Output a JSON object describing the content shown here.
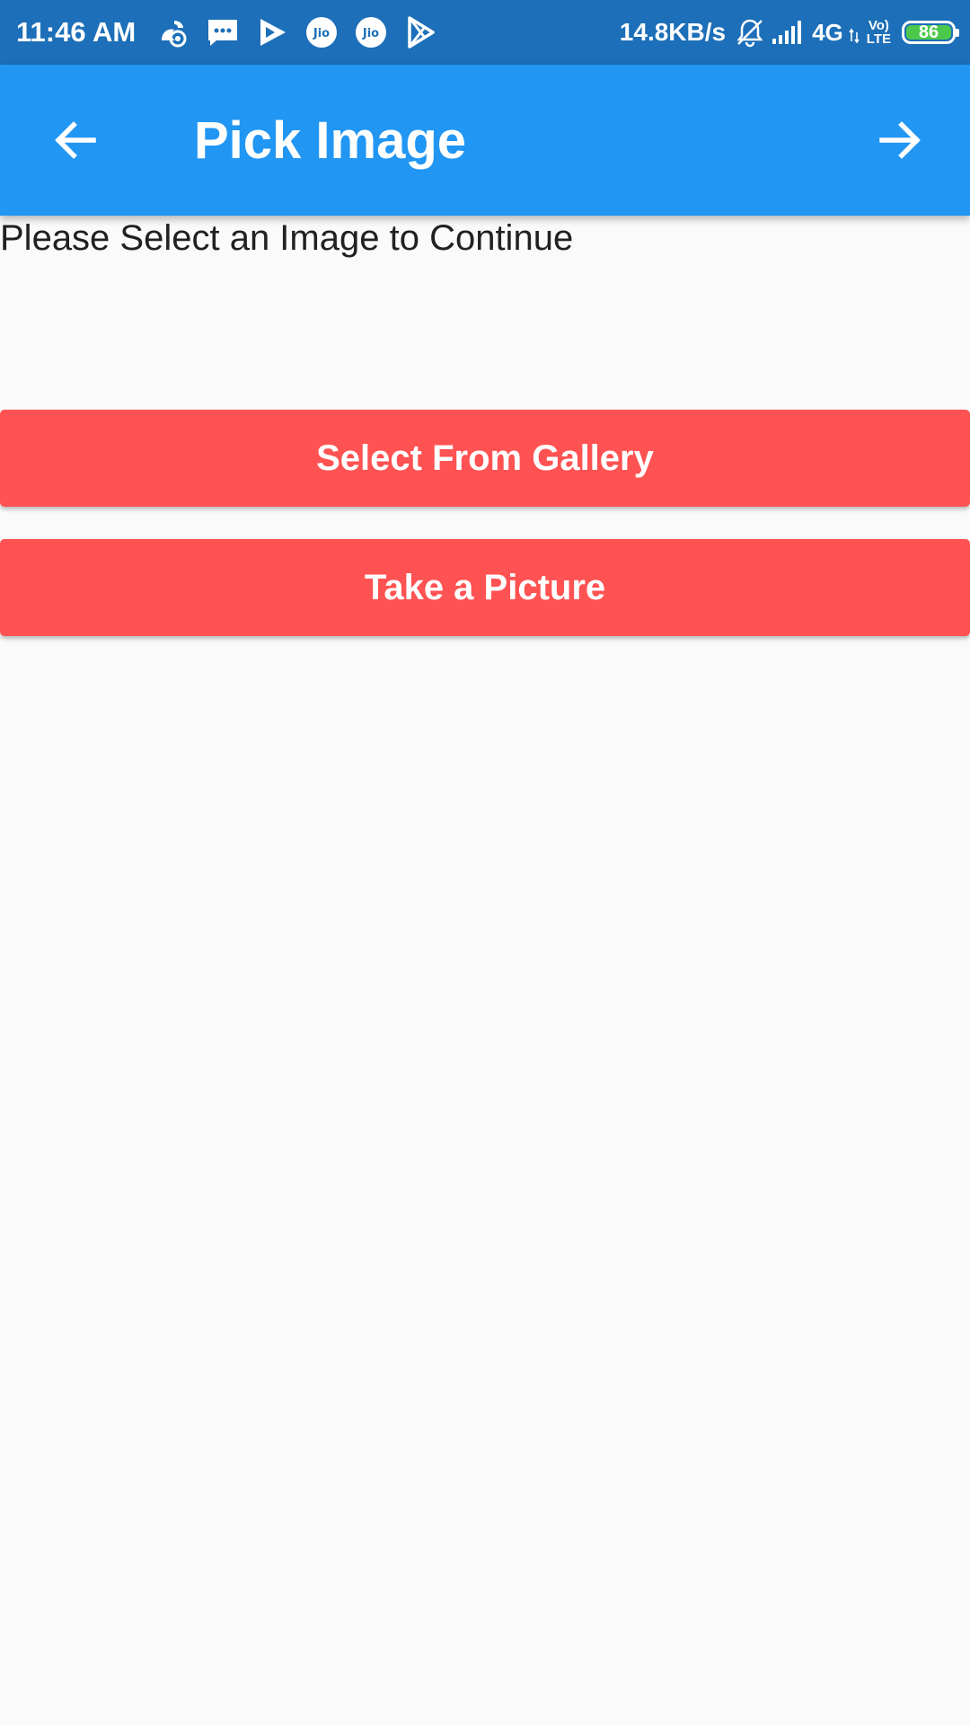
{
  "status_bar": {
    "time": "11:46 AM",
    "notification_icons": [
      "uc-browser-icon",
      "message-icon",
      "play-movies-icon",
      "jio-icon",
      "jio-icon",
      "play-store-icon"
    ],
    "network_speed": "14.8KB/s",
    "network_type": "4G",
    "volte_line1": "Vo)",
    "volte_line2": "LTE",
    "battery_level": "86",
    "battery_color": "#4cc94c",
    "background_color": "#1c6fb8"
  },
  "app_bar": {
    "title": "Pick Image",
    "back_icon": "arrow-back-icon",
    "forward_icon": "arrow-forward-icon",
    "background_color": "#2196f3"
  },
  "content": {
    "prompt": "Please Select an Image to Continue",
    "buttons": {
      "gallery_label": "Select From Gallery",
      "camera_label": "Take a Picture",
      "color": "#ff5252"
    }
  }
}
